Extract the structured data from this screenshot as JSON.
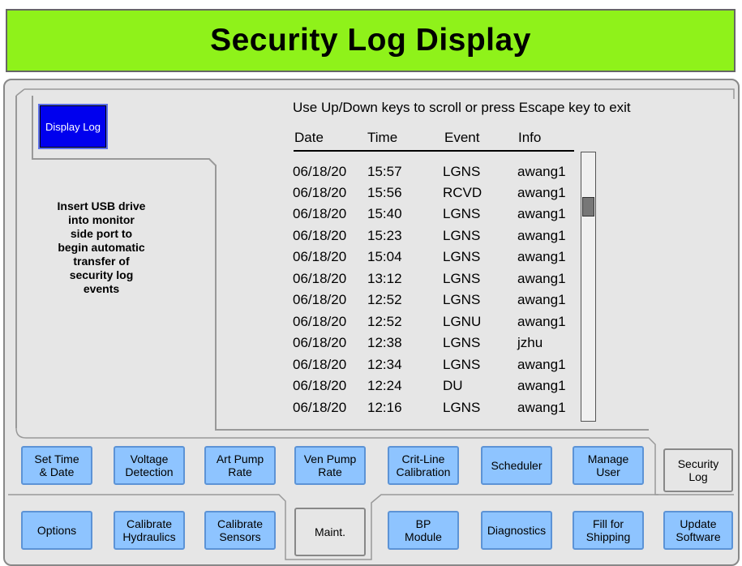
{
  "header": {
    "title": "Security Log Display"
  },
  "left_panel": {
    "display_log_button": "Display Log",
    "usb_message": "Insert USB drive\ninto monitor\nside port to\nbegin automatic\ntransfer of\nsecurity log\nevents"
  },
  "log": {
    "instruction": "Use Up/Down keys to scroll or press Escape key to exit",
    "columns": {
      "date": "Date",
      "time": "Time",
      "event": "Event",
      "info": "Info"
    },
    "rows": [
      {
        "date": "06/18/20",
        "time": "15:57",
        "event": "LGNS",
        "info": "awang1"
      },
      {
        "date": "06/18/20",
        "time": "15:56",
        "event": "RCVD",
        "info": "awang1"
      },
      {
        "date": "06/18/20",
        "time": "15:40",
        "event": "LGNS",
        "info": "awang1"
      },
      {
        "date": "06/18/20",
        "time": "15:23",
        "event": "LGNS",
        "info": "awang1"
      },
      {
        "date": "06/18/20",
        "time": "15:04",
        "event": "LGNS",
        "info": "awang1"
      },
      {
        "date": "06/18/20",
        "time": "13:12",
        "event": "LGNS",
        "info": "awang1"
      },
      {
        "date": "06/18/20",
        "time": "12:52",
        "event": "LGNS",
        "info": "awang1"
      },
      {
        "date": "06/18/20",
        "time": "12:52",
        "event": "LGNU",
        "info": "awang1"
      },
      {
        "date": "06/18/20",
        "time": "12:38",
        "event": "LGNS",
        "info": "jzhu"
      },
      {
        "date": "06/18/20",
        "time": "12:34",
        "event": "LGNS",
        "info": "awang1"
      },
      {
        "date": "06/18/20",
        "time": "12:24",
        "event": "DU",
        "info": "awang1"
      },
      {
        "date": "06/18/20",
        "time": "12:16",
        "event": "LGNS",
        "info": "awang1"
      }
    ]
  },
  "tabs_row1": [
    {
      "label": "Set Time\n& Date"
    },
    {
      "label": "Voltage\nDetection"
    },
    {
      "label": "Art Pump\nRate"
    },
    {
      "label": "Ven Pump\nRate"
    },
    {
      "label": "Crit-Line\nCalibration"
    },
    {
      "label": "Scheduler"
    },
    {
      "label": "Manage\nUser"
    },
    {
      "label": "Security\nLog"
    }
  ],
  "tabs_row2": [
    {
      "label": "Options"
    },
    {
      "label": "Calibrate\nHydraulics"
    },
    {
      "label": "Calibrate\nSensors"
    },
    {
      "label": "Maint."
    },
    {
      "label": "BP\nModule"
    },
    {
      "label": "Diagnostics"
    },
    {
      "label": "Fill for\nShipping"
    },
    {
      "label": "Update\nSoftware"
    }
  ],
  "colors": {
    "title_bar": "#8ff21a",
    "tab_button": "#8ec4ff",
    "display_log_button": "#0000ee",
    "panel": "#e6e6e6"
  }
}
